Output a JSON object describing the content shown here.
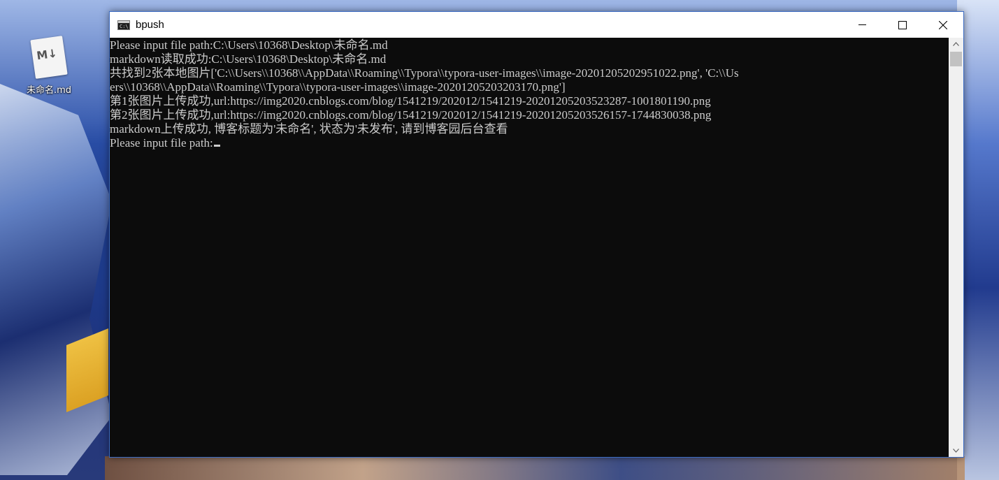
{
  "desktop": {
    "icon_label": "未命名.md",
    "icon_glyph": "M↓"
  },
  "window": {
    "title": "bpush",
    "app_icon_glyph": "C:\\",
    "controls": [
      "minimize",
      "maximize",
      "close"
    ]
  },
  "console": {
    "lines": [
      "Please input file path:C:\\Users\\10368\\Desktop\\未命名.md",
      "markdown读取成功:C:\\Users\\10368\\Desktop\\未命名.md",
      "共找到2张本地图片['C:\\\\Users\\\\10368\\\\AppData\\\\Roaming\\\\Typora\\\\typora-user-images\\\\image-20201205202951022.png', 'C:\\\\Us",
      "ers\\\\10368\\\\AppData\\\\Roaming\\\\Typora\\\\typora-user-images\\\\image-20201205203203170.png']",
      "第1张图片上传成功,url:https://img2020.cnblogs.com/blog/1541219/202012/1541219-20201205203523287-1001801190.png",
      "第2张图片上传成功,url:https://img2020.cnblogs.com/blog/1541219/202012/1541219-20201205203526157-1744830038.png",
      "markdown上传成功, 博客标题为'未命名', 状态为'未发布', 请到博客园后台查看"
    ],
    "prompt": "Please input file path:"
  },
  "colors": {
    "console_bg": "#0c0c0c",
    "console_fg": "#cccccc",
    "window_border": "#3c6cc4"
  }
}
